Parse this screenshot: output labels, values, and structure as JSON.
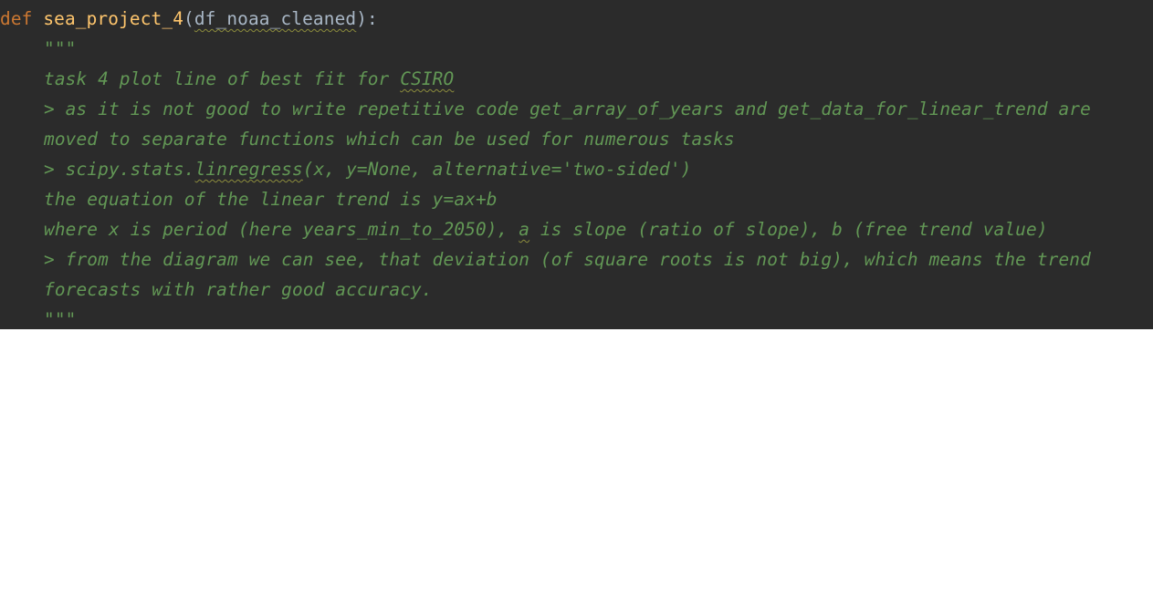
{
  "code": {
    "def_keyword": "def",
    "function_name": "sea_project_4",
    "open_paren": "(",
    "parameter": "df_noaa_cleaned",
    "close_paren_colon": "):",
    "docstring": {
      "open_quotes": "\"\"\"",
      "line1_text": "task 4 plot line of best fit for ",
      "line1_typo": "CSIRO",
      "line2": "> as it is not good to write repetitive code get_array_of_years and get_data_for_linear_trend are",
      "line3": "moved to separate functions which can be used for numerous tasks",
      "line4_prefix": "> scipy.stats.",
      "line4_typo": "linregress",
      "line4_suffix": "(x, y=None, alternative='two-sided')",
      "line5": "the equation of the linear trend is y=ax+b",
      "line6_prefix": "where x is period (here years_min_to_2050), ",
      "line6_typo": "a",
      "line6_suffix": " is slope (ratio of slope), b (free trend value)",
      "line7": "> from the diagram we can see, that deviation (of square roots is not big), which means the trend",
      "line8": "forecasts with rather good accuracy.",
      "close_quotes": "\"\"\""
    }
  },
  "colors": {
    "editor_background": "#2b2b2b",
    "keyword": "#cc7832",
    "function_name": "#ffc66d",
    "identifier": "#a9b7c6",
    "docstring": "#629755",
    "typo_underline": "#8c8c3c"
  }
}
